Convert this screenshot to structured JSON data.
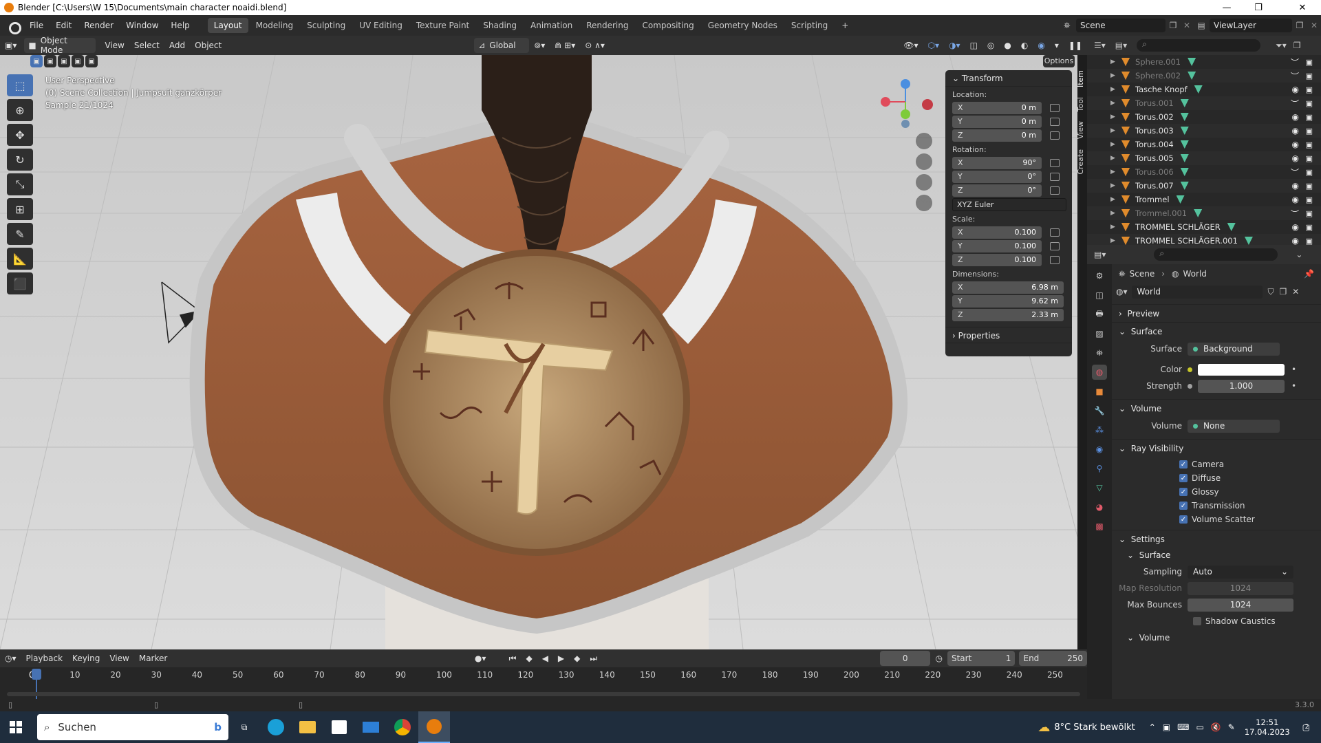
{
  "window": {
    "title": "Blender [C:\\Users\\W 15\\Documents\\main character noaidi.blend]",
    "minimize": "—",
    "maximize": "❐",
    "close": "✕"
  },
  "menu": {
    "items": [
      "File",
      "Edit",
      "Render",
      "Window",
      "Help"
    ],
    "workspaces": [
      "Layout",
      "Modeling",
      "Sculpting",
      "UV Editing",
      "Texture Paint",
      "Shading",
      "Animation",
      "Rendering",
      "Compositing",
      "Geometry Nodes",
      "Scripting",
      "+"
    ],
    "active_workspace": "Layout",
    "scene": "Scene",
    "view_layer": "ViewLayer"
  },
  "viewport_header": {
    "mode": "Object Mode",
    "menus": [
      "View",
      "Select",
      "Add",
      "Object"
    ],
    "orientation": "Global",
    "options": "Options"
  },
  "viewport": {
    "overlay_lines": [
      "User Perspective",
      "(0) Scene Collection | Jumpsuit ganzkörper",
      "Sample 21/1024"
    ]
  },
  "npanel": {
    "title": "Transform",
    "location_label": "Location:",
    "location": [
      {
        "axis": "X",
        "value": "0 m"
      },
      {
        "axis": "Y",
        "value": "0 m"
      },
      {
        "axis": "Z",
        "value": "0 m"
      }
    ],
    "rotation_label": "Rotation:",
    "rotation": [
      {
        "axis": "X",
        "value": "90°"
      },
      {
        "axis": "Y",
        "value": "0°"
      },
      {
        "axis": "Z",
        "value": "0°"
      }
    ],
    "rotation_mode": "XYZ Euler",
    "scale_label": "Scale:",
    "scale": [
      {
        "axis": "X",
        "value": "0.100"
      },
      {
        "axis": "Y",
        "value": "0.100"
      },
      {
        "axis": "Z",
        "value": "0.100"
      }
    ],
    "dimensions_label": "Dimensions:",
    "dimensions": [
      {
        "axis": "X",
        "value": "6.98 m"
      },
      {
        "axis": "Y",
        "value": "9.62 m"
      },
      {
        "axis": "Z",
        "value": "2.33 m"
      }
    ],
    "properties": "Properties",
    "tabs": [
      "Item",
      "Tool",
      "View",
      "Create"
    ]
  },
  "outliner": {
    "items": [
      {
        "name": "Sphere.001",
        "dim": true
      },
      {
        "name": "Sphere.002",
        "dim": true
      },
      {
        "name": "Tasche Knopf",
        "dim": false
      },
      {
        "name": "Torus.001",
        "dim": true
      },
      {
        "name": "Torus.002",
        "dim": false
      },
      {
        "name": "Torus.003",
        "dim": false
      },
      {
        "name": "Torus.004",
        "dim": false
      },
      {
        "name": "Torus.005",
        "dim": false
      },
      {
        "name": "Torus.006",
        "dim": true
      },
      {
        "name": "Torus.007",
        "dim": false
      },
      {
        "name": "Trommel",
        "dim": false
      },
      {
        "name": "Trommel.001",
        "dim": true
      },
      {
        "name": "TROMMEL SCHLÄGER",
        "dim": false
      },
      {
        "name": "TROMMEL SCHLÄGER.001",
        "dim": false
      }
    ]
  },
  "properties": {
    "breadcrumb": [
      "Scene",
      "World"
    ],
    "world_name": "World",
    "sections": {
      "preview": "Preview",
      "surface": "Surface",
      "volume": "Volume",
      "ray_visibility": "Ray Visibility",
      "settings": "Settings",
      "settings_surface": "Surface",
      "settings_volume": "Volume"
    },
    "surface_label": "Surface",
    "surface_value": "Background",
    "color_label": "Color",
    "strength_label": "Strength",
    "strength_value": "1.000",
    "volume_label": "Volume",
    "volume_value": "None",
    "ray_visibility": [
      "Camera",
      "Diffuse",
      "Glossy",
      "Transmission",
      "Volume Scatter"
    ],
    "sampling_label": "Sampling",
    "sampling_value": "Auto",
    "map_resolution_label": "Map Resolution",
    "map_resolution_value": "1024",
    "max_bounces_label": "Max Bounces",
    "max_bounces_value": "1024",
    "shadow_caustics": "Shadow Caustics"
  },
  "timeline": {
    "menus": [
      "Playback",
      "Keying",
      "View",
      "Marker"
    ],
    "current_frame": "0",
    "start_label": "Start",
    "start": "1",
    "end_label": "End",
    "end": "250",
    "frames": [
      "0",
      "10",
      "20",
      "30",
      "40",
      "50",
      "60",
      "70",
      "80",
      "90",
      "100",
      "110",
      "120",
      "130",
      "140",
      "150",
      "160",
      "170",
      "180",
      "190",
      "200",
      "210",
      "220",
      "230",
      "240",
      "250"
    ]
  },
  "status": {
    "version": "3.3.0"
  },
  "taskbar": {
    "search": "Suchen",
    "weather": "8°C  Stark bewölkt",
    "time": "12:51",
    "date": "17.04.2023",
    "notifications": "2"
  },
  "colors": {
    "accent": "#4772b3",
    "object": "#e08b2c",
    "mesh": "#54c29d",
    "coat": "#9a5a35",
    "fur": "#c9c9c9"
  }
}
